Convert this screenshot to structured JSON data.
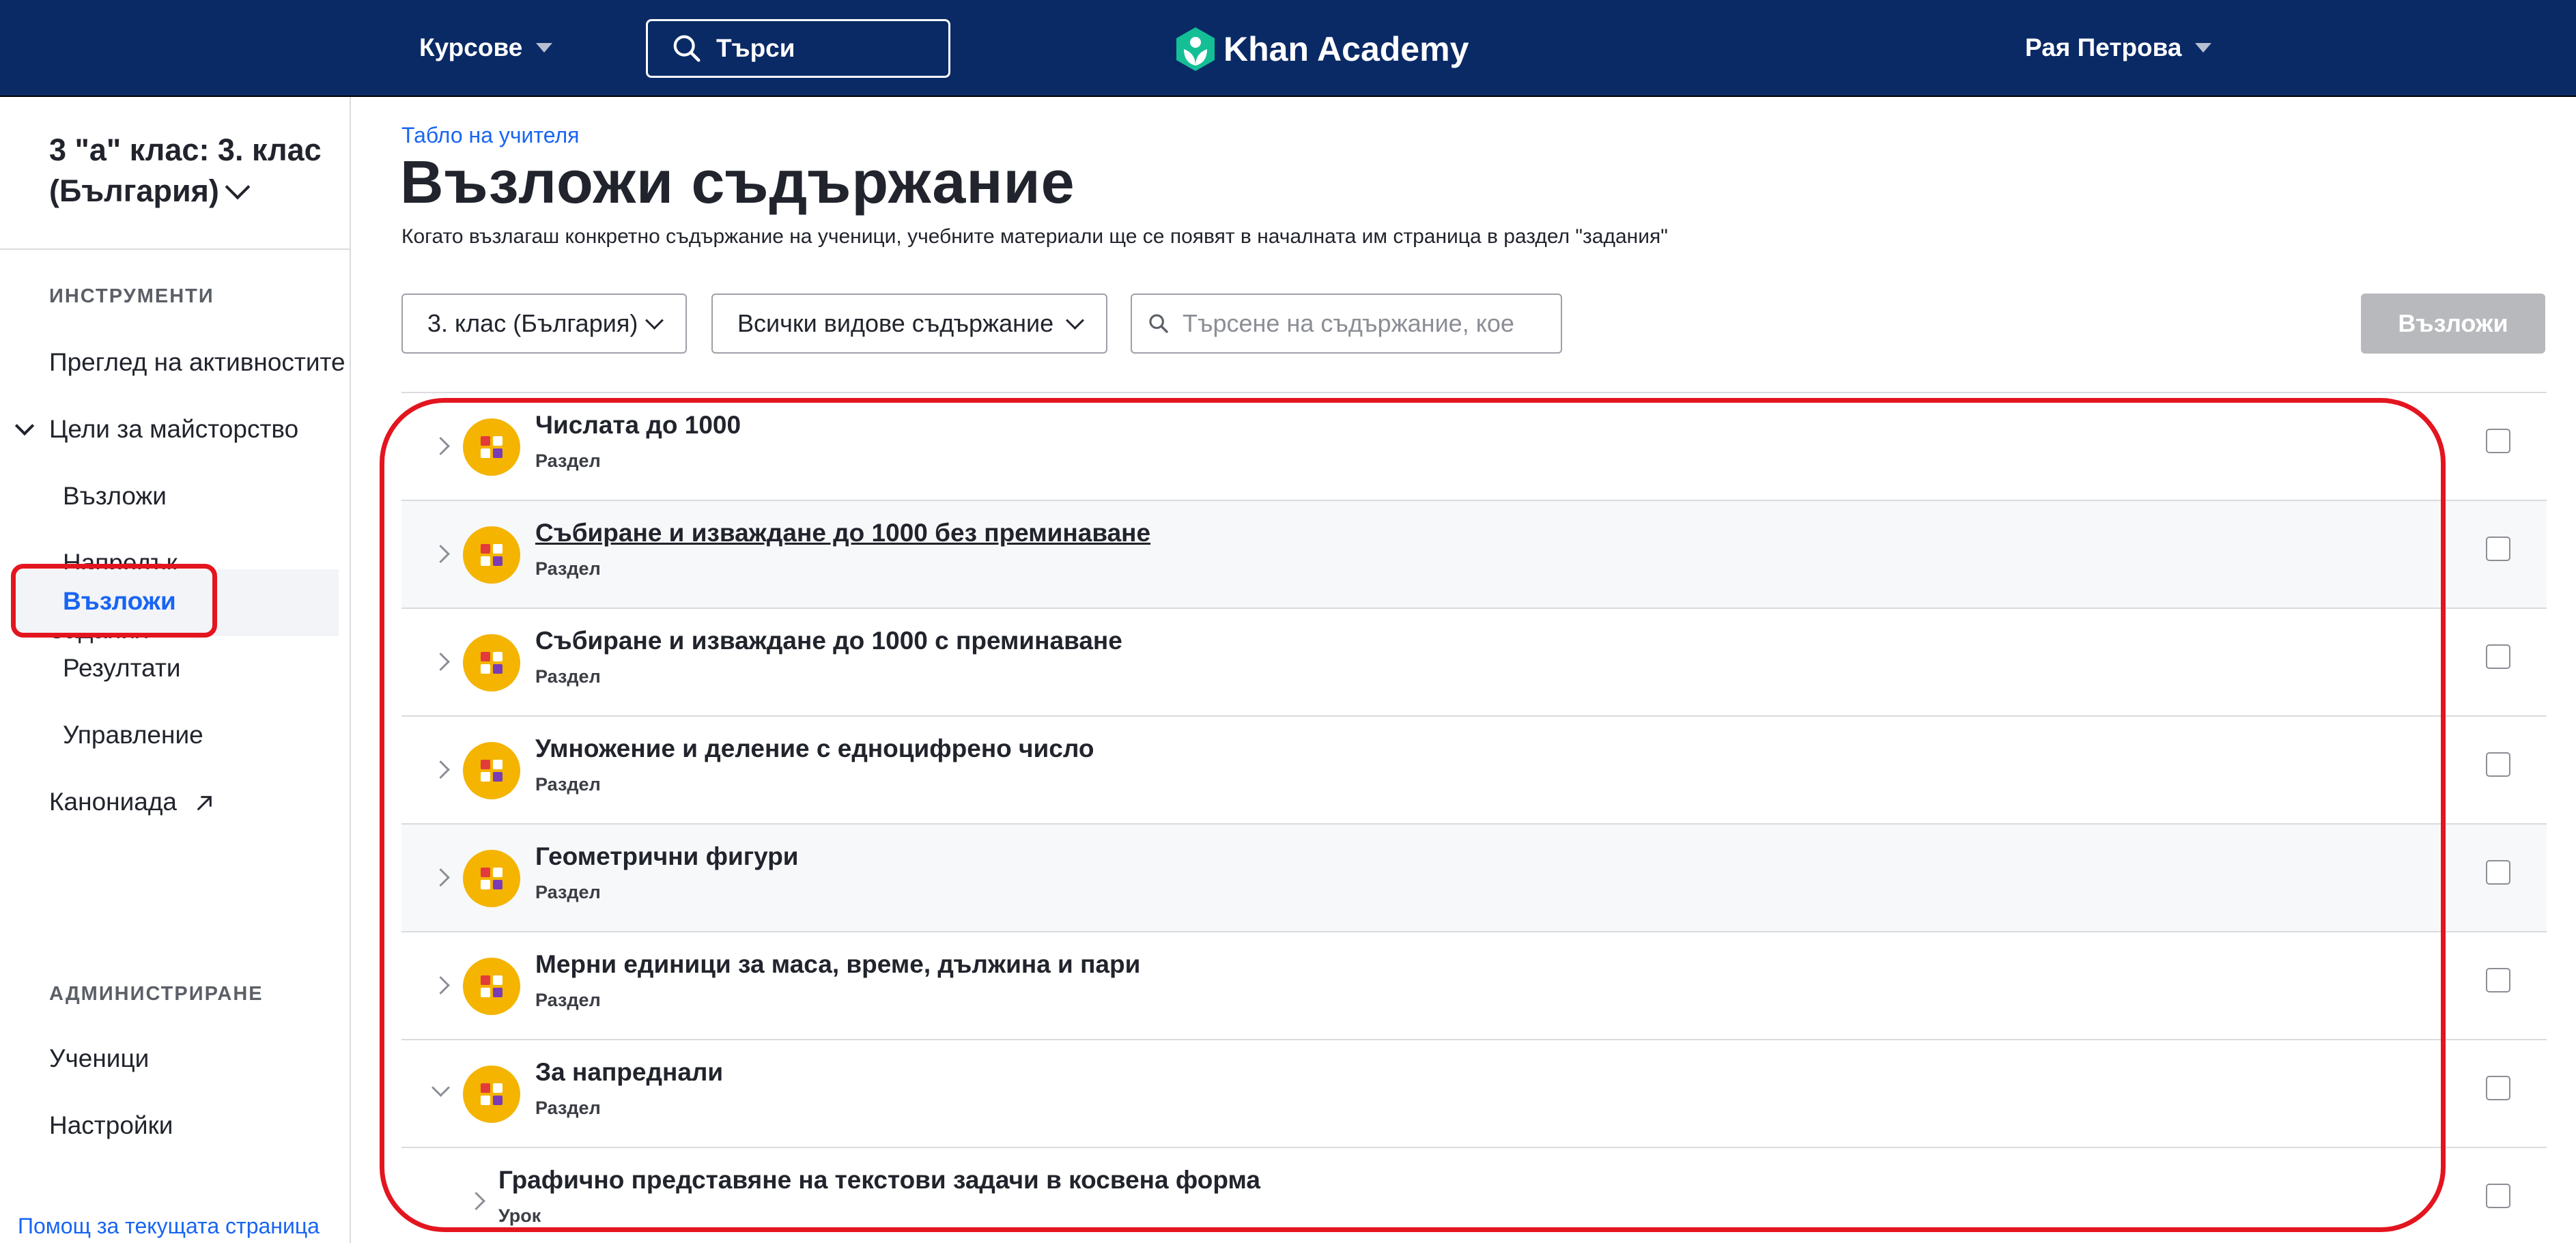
{
  "topbar": {
    "courses_label": "Курсове",
    "search_label": "Търси",
    "logo_text": "Khan Academy",
    "user_name": "Рая Петрова",
    "bg_color": "#0a2a66"
  },
  "sidebar": {
    "class_name": "3 \"а\" клас: 3. клас (България)",
    "tools_heading": "ИНСТРУМЕНТИ",
    "activity_overview": "Преглед на активностите",
    "mastery_goals": "Цели за майсторство",
    "mastery_assign": "Възложи",
    "mastery_progress": "Напредък",
    "assignments": "Задания",
    "assignments_assign": "Възложи",
    "assignments_results": "Резултати",
    "assignments_manage": "Управление",
    "kanoniada": "Канониада",
    "admin_heading": "АДМИНИСТРИРАНЕ",
    "students": "Ученици",
    "settings": "Настройки",
    "help_link": "Помощ за текущата страница"
  },
  "main": {
    "breadcrumb": "Табло на учителя",
    "title": "Възложи съдържание",
    "description": "Когато възлагаш конкретно съдържание на ученици, учебните материали ще се появят в началната им страница в раздел \"задания\"",
    "filter_grade": "3. клас (България)",
    "filter_type": "Всички видове съдържание",
    "search_placeholder": "Търсене на съдържание, кое",
    "assign_button": "Възложи",
    "accent_color": "#1865f2",
    "highlight_color": "#e3151f"
  },
  "content_rows": [
    {
      "title": "Числата до 1000",
      "type": "Раздел"
    },
    {
      "title": "Събиране и изваждане до 1000 без преминаване",
      "type": "Раздел"
    },
    {
      "title": "Събиране и изваждане до 1000 с преминаване",
      "type": "Раздел"
    },
    {
      "title": "Умножение и деление с едноцифрено число",
      "type": "Раздел"
    },
    {
      "title": "Геометрични фигури",
      "type": "Раздел"
    },
    {
      "title": "Мерни единици за маса, време, дължина и пари",
      "type": "Раздел"
    },
    {
      "title": "За напреднали",
      "type": "Раздел"
    },
    {
      "title": "Графично представяне на текстови задачи в косвена форма",
      "type": "Урок"
    }
  ]
}
